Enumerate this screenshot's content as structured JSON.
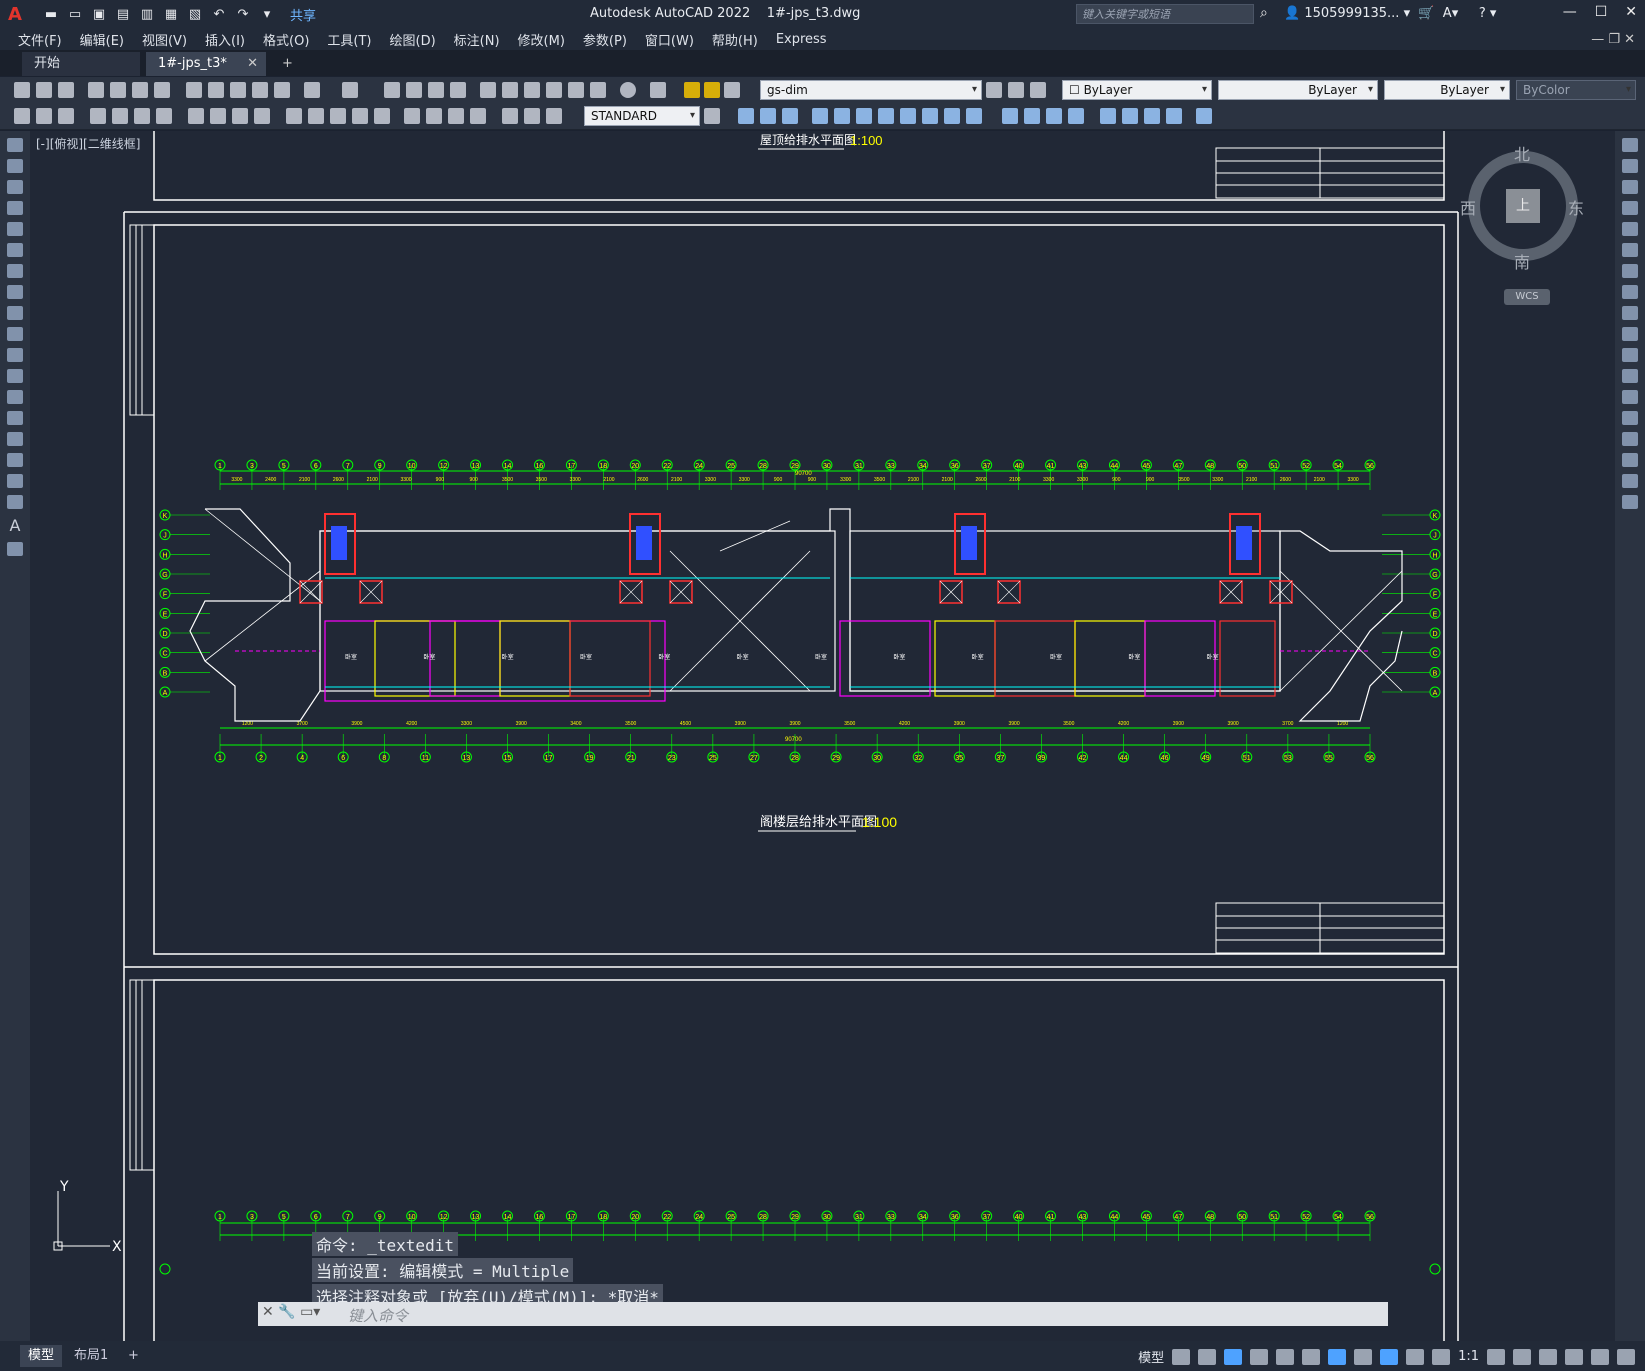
{
  "titlebar": {
    "logo": "A",
    "share_label": "共享",
    "app_title": "Autodesk AutoCAD 2022",
    "file_title": "1#-jps_t3.dwg",
    "search_placeholder": "键入关键字或短语",
    "user_name": "1505999135...",
    "minimize": "—",
    "maximize": "☐",
    "close": "✕"
  },
  "menus": [
    "文件(F)",
    "编辑(E)",
    "视图(V)",
    "插入(I)",
    "格式(O)",
    "工具(T)",
    "绘图(D)",
    "标注(N)",
    "修改(M)",
    "参数(P)",
    "窗口(W)",
    "帮助(H)",
    "Express"
  ],
  "tabs": {
    "start": "开始",
    "file": "1#-jps_t3*",
    "close": "✕",
    "add": "+"
  },
  "toolbar": {
    "layer": "gs-dim",
    "textstyle": "STANDARD",
    "color": "ByLayer",
    "linetype": "ByLayer",
    "lineweight": "ByLayer",
    "plotstyle": "ByColor"
  },
  "canvas": {
    "view_label": "[-][俯视][二维线框]",
    "title_top": "屋顶给排水平面图",
    "title_main": "阁楼层给排水平面图",
    "scale": "1:100",
    "compass": {
      "n": "北",
      "s": "南",
      "e": "东",
      "w": "西",
      "center": "上"
    },
    "wcs": "WCS",
    "ucs_x": "X",
    "ucs_y": "Y",
    "dim_total": "90700",
    "row_letters": [
      "K",
      "J",
      "H",
      "G",
      "F",
      "E",
      "D",
      "C",
      "B",
      "A"
    ],
    "top_axes": [
      "1",
      "3",
      "5",
      "6",
      "7",
      "9",
      "10",
      "12",
      "13",
      "14",
      "16",
      "17",
      "18",
      "20",
      "22",
      "24",
      "25",
      "28",
      "29",
      "30",
      "31",
      "33",
      "34",
      "36",
      "37",
      "40",
      "41",
      "43",
      "44",
      "45",
      "47",
      "48",
      "50",
      "51",
      "52",
      "54",
      "56"
    ],
    "bottom_axes": [
      "1",
      "2",
      "4",
      "6",
      "8",
      "11",
      "13",
      "15",
      "17",
      "19",
      "21",
      "23",
      "25",
      "27",
      "28",
      "29",
      "30",
      "32",
      "35",
      "37",
      "39",
      "42",
      "44",
      "46",
      "49",
      "51",
      "53",
      "55",
      "56"
    ],
    "top_dims": [
      "3300",
      "2400",
      "2100",
      "2600",
      "2100",
      "3300",
      "900",
      "900",
      "3500",
      "3500",
      "3300",
      "2100",
      "2600",
      "2100",
      "3300",
      "3300",
      "900",
      "900",
      "3300",
      "3500",
      "2100",
      "2100",
      "2600",
      "2100",
      "3300",
      "3300",
      "900",
      "900",
      "3500",
      "3300",
      "2100",
      "2600",
      "2100",
      "3300"
    ],
    "bottom_dims": [
      "1200",
      "3700",
      "3900",
      "4200",
      "3300",
      "3900",
      "3400",
      "3500",
      "4500",
      "3900",
      "3900",
      "3500",
      "4200",
      "3900",
      "3900",
      "3500",
      "4200",
      "3900",
      "3900",
      "3700",
      "1200"
    ],
    "room_labels": [
      "卧室",
      "卧室",
      "卧室",
      "卧室",
      "卧室",
      "卧室",
      "卧室",
      "卧室",
      "卧室",
      "卧室",
      "卧室",
      "卧室"
    ]
  },
  "command": {
    "history": [
      "命令: _textedit",
      "当前设置: 编辑模式 = Multiple",
      "选择注释对象或 [放弃(U)/模式(M)]: *取消*"
    ],
    "placeholder": "键入命令"
  },
  "status": {
    "model_tab": "模型",
    "layout_tab": "布局1",
    "add": "+",
    "model_label": "模型",
    "scale": "1:1"
  },
  "colors": {
    "wall": "#ffffff",
    "axis": "#00ff00",
    "pipe_cyan": "#00ffff",
    "pipe_magenta": "#ff00ff",
    "pipe_red": "#ff3030",
    "yellow": "#ffff00",
    "blue": "#3050ff"
  }
}
